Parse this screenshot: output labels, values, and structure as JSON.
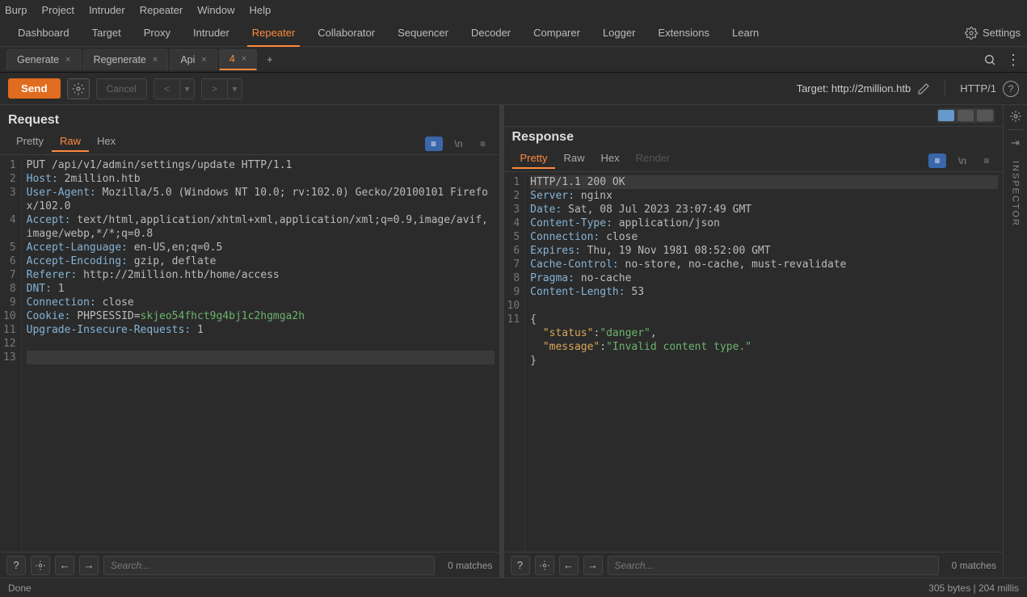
{
  "menu": {
    "items": [
      "Burp",
      "Project",
      "Intruder",
      "Repeater",
      "Window",
      "Help"
    ]
  },
  "main_tabs": [
    "Dashboard",
    "Target",
    "Proxy",
    "Intruder",
    "Repeater",
    "Collaborator",
    "Sequencer",
    "Decoder",
    "Comparer",
    "Logger",
    "Extensions",
    "Learn"
  ],
  "main_tab_active": "Repeater",
  "settings_label": "Settings",
  "sub_tabs": [
    {
      "label": "Generate",
      "close": true
    },
    {
      "label": "Regenerate",
      "close": true
    },
    {
      "label": "Api",
      "close": true
    },
    {
      "label": "4",
      "close": true,
      "active": true
    }
  ],
  "toolbar": {
    "send": "Send",
    "cancel": "Cancel",
    "target_prefix": "Target: ",
    "target": "http://2million.htb",
    "protocol": "HTTP/1"
  },
  "request": {
    "title": "Request",
    "tabs": [
      "Pretty",
      "Raw",
      "Hex"
    ],
    "active": "Raw",
    "search_placeholder": "Search...",
    "matches": "0 matches",
    "lines": [
      {
        "n": 1,
        "segs": [
          {
            "c": "v",
            "t": "PUT /api/v1/admin/settings/update HTTP/1.1"
          }
        ]
      },
      {
        "n": 2,
        "segs": [
          {
            "c": "h",
            "t": "Host:"
          },
          {
            "c": "v",
            "t": " 2million.htb"
          }
        ]
      },
      {
        "n": 3,
        "segs": [
          {
            "c": "h",
            "t": "User-Agent:"
          },
          {
            "c": "v",
            "t": " Mozilla/5.0 (Windows NT 10.0; rv:102.0) Gecko/20100101 Firefox/102.0"
          }
        ]
      },
      {
        "n": 4,
        "segs": [
          {
            "c": "h",
            "t": "Accept:"
          },
          {
            "c": "v",
            "t": " text/html,application/xhtml+xml,application/xml;q=0.9,image/avif,image/webp,*/*;q=0.8"
          }
        ]
      },
      {
        "n": 5,
        "segs": [
          {
            "c": "h",
            "t": "Accept-Language:"
          },
          {
            "c": "v",
            "t": " en-US,en;q=0.5"
          }
        ]
      },
      {
        "n": 6,
        "segs": [
          {
            "c": "h",
            "t": "Accept-Encoding:"
          },
          {
            "c": "v",
            "t": " gzip, deflate"
          }
        ]
      },
      {
        "n": 7,
        "segs": [
          {
            "c": "h",
            "t": "Referer:"
          },
          {
            "c": "v",
            "t": " http://2million.htb/home/access"
          }
        ]
      },
      {
        "n": 8,
        "segs": [
          {
            "c": "h",
            "t": "DNT:"
          },
          {
            "c": "v",
            "t": " 1"
          }
        ]
      },
      {
        "n": 9,
        "segs": [
          {
            "c": "h",
            "t": "Connection:"
          },
          {
            "c": "v",
            "t": " close"
          }
        ]
      },
      {
        "n": 10,
        "segs": [
          {
            "c": "h",
            "t": "Cookie:"
          },
          {
            "c": "v",
            "t": " PHPSESSID="
          },
          {
            "c": "sess",
            "t": "skjeo54fhct9g4bj1c2hgmga2h"
          }
        ]
      },
      {
        "n": 11,
        "segs": [
          {
            "c": "h",
            "t": "Upgrade-Insecure-Requests:"
          },
          {
            "c": "v",
            "t": " 1"
          }
        ]
      },
      {
        "n": 12,
        "segs": []
      },
      {
        "n": 13,
        "segs": [],
        "hl": true
      }
    ]
  },
  "response": {
    "title": "Response",
    "tabs": [
      "Pretty",
      "Raw",
      "Hex",
      "Render"
    ],
    "active": "Pretty",
    "search_placeholder": "Search...",
    "matches": "0 matches",
    "lines": [
      {
        "n": 1,
        "segs": [
          {
            "c": "v",
            "t": "HTTP/1.1 200 OK"
          }
        ],
        "hl": true
      },
      {
        "n": 2,
        "segs": [
          {
            "c": "h",
            "t": "Server:"
          },
          {
            "c": "v",
            "t": " nginx"
          }
        ]
      },
      {
        "n": 3,
        "segs": [
          {
            "c": "h",
            "t": "Date:"
          },
          {
            "c": "v",
            "t": " Sat, 08 Jul 2023 23:07:49 GMT"
          }
        ]
      },
      {
        "n": 4,
        "segs": [
          {
            "c": "h",
            "t": "Content-Type:"
          },
          {
            "c": "v",
            "t": " application/json"
          }
        ]
      },
      {
        "n": 5,
        "segs": [
          {
            "c": "h",
            "t": "Connection:"
          },
          {
            "c": "v",
            "t": " close"
          }
        ]
      },
      {
        "n": 6,
        "segs": [
          {
            "c": "h",
            "t": "Expires:"
          },
          {
            "c": "v",
            "t": " Thu, 19 Nov 1981 08:52:00 GMT"
          }
        ]
      },
      {
        "n": 7,
        "segs": [
          {
            "c": "h",
            "t": "Cache-Control:"
          },
          {
            "c": "v",
            "t": " no-store, no-cache, must-revalidate"
          }
        ]
      },
      {
        "n": 8,
        "segs": [
          {
            "c": "h",
            "t": "Pragma:"
          },
          {
            "c": "v",
            "t": " no-cache"
          }
        ]
      },
      {
        "n": 9,
        "segs": [
          {
            "c": "h",
            "t": "Content-Length:"
          },
          {
            "c": "v",
            "t": " 53"
          }
        ]
      },
      {
        "n": 10,
        "segs": []
      },
      {
        "n": 11,
        "segs": [
          {
            "c": "v",
            "t": "{"
          },
          {
            "c": "br",
            "t": "\n  "
          },
          {
            "c": "k",
            "t": "\"status\""
          },
          {
            "c": "v",
            "t": ":"
          },
          {
            "c": "s",
            "t": "\"danger\""
          },
          {
            "c": "v",
            "t": ","
          },
          {
            "c": "br",
            "t": "\n  "
          },
          {
            "c": "k",
            "t": "\"message\""
          },
          {
            "c": "v",
            "t": ":"
          },
          {
            "c": "s",
            "t": "\"Invalid content type.\""
          },
          {
            "c": "br",
            "t": "\n"
          },
          {
            "c": "v",
            "t": "}"
          }
        ]
      }
    ]
  },
  "inspector": "INSPECTOR",
  "status": {
    "left": "Done",
    "right": "305 bytes | 204 millis"
  }
}
